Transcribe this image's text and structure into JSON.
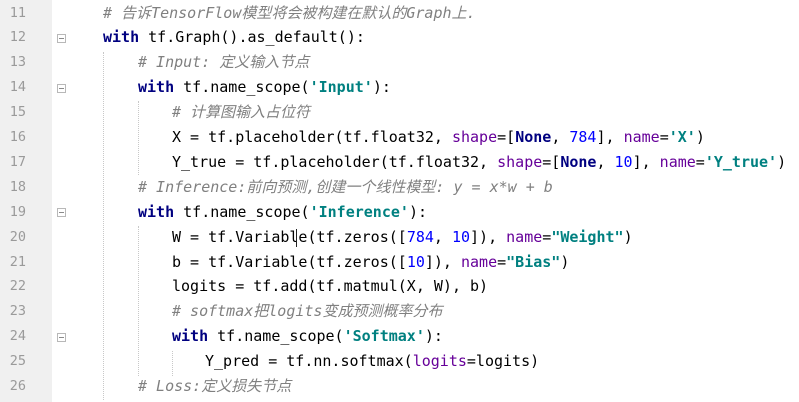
{
  "editor": {
    "lines": [
      {
        "number": "11",
        "tokens": [
          {
            "type": "comment",
            "text": "# 告诉TensorFlow模型将会被构建在默认的Graph上."
          }
        ]
      },
      {
        "number": "12",
        "tokens": [
          {
            "type": "kw",
            "text": "with"
          },
          {
            "type": "plain",
            "text": " tf.Graph().as_default():"
          }
        ]
      },
      {
        "number": "13",
        "tokens": [
          {
            "type": "comment",
            "text": "# Input: 定义输入节点"
          }
        ]
      },
      {
        "number": "14",
        "tokens": [
          {
            "type": "kw",
            "text": "with"
          },
          {
            "type": "plain",
            "text": " tf.name_scope("
          },
          {
            "type": "str",
            "text": "'Input'"
          },
          {
            "type": "plain",
            "text": "):"
          }
        ]
      },
      {
        "number": "15",
        "tokens": [
          {
            "type": "comment",
            "text": "# 计算图输入占位符"
          }
        ]
      },
      {
        "number": "16",
        "tokens": [
          {
            "type": "plain",
            "text": "X = tf.placeholder(tf.float32, "
          },
          {
            "type": "kwarg",
            "text": "shape"
          },
          {
            "type": "plain",
            "text": "=["
          },
          {
            "type": "const",
            "text": "None"
          },
          {
            "type": "plain",
            "text": ", "
          },
          {
            "type": "num",
            "text": "784"
          },
          {
            "type": "plain",
            "text": "], "
          },
          {
            "type": "kwarg",
            "text": "name"
          },
          {
            "type": "plain",
            "text": "="
          },
          {
            "type": "str",
            "text": "'X'"
          },
          {
            "type": "plain",
            "text": ")"
          }
        ]
      },
      {
        "number": "17",
        "tokens": [
          {
            "type": "plain",
            "text": "Y_true = tf.placeholder(tf.float32, "
          },
          {
            "type": "kwarg",
            "text": "shape"
          },
          {
            "type": "plain",
            "text": "=["
          },
          {
            "type": "const",
            "text": "None"
          },
          {
            "type": "plain",
            "text": ", "
          },
          {
            "type": "num",
            "text": "10"
          },
          {
            "type": "plain",
            "text": "], "
          },
          {
            "type": "kwarg",
            "text": "name"
          },
          {
            "type": "plain",
            "text": "="
          },
          {
            "type": "str",
            "text": "'Y_true'"
          },
          {
            "type": "plain",
            "text": ")"
          }
        ]
      },
      {
        "number": "18",
        "tokens": [
          {
            "type": "comment",
            "text": "# Inference:前向预测,创建一个线性模型: y = x*w + b"
          }
        ]
      },
      {
        "number": "19",
        "tokens": [
          {
            "type": "kw",
            "text": "with"
          },
          {
            "type": "plain",
            "text": " tf.name_scope("
          },
          {
            "type": "str",
            "text": "'Inference'"
          },
          {
            "type": "plain",
            "text": "):"
          }
        ]
      },
      {
        "number": "20",
        "tokens": [
          {
            "type": "plain",
            "text": "W = tf.Variable(tf.zeros(["
          },
          {
            "type": "num",
            "text": "784"
          },
          {
            "type": "plain",
            "text": ", "
          },
          {
            "type": "num",
            "text": "10"
          },
          {
            "type": "plain",
            "text": "]), "
          },
          {
            "type": "kwarg",
            "text": "name"
          },
          {
            "type": "plain",
            "text": "="
          },
          {
            "type": "str",
            "text": "\"Weight\""
          },
          {
            "type": "plain",
            "text": ")"
          }
        ]
      },
      {
        "number": "21",
        "tokens": [
          {
            "type": "plain",
            "text": "b = tf.Variable(tf.zeros(["
          },
          {
            "type": "num",
            "text": "10"
          },
          {
            "type": "plain",
            "text": "]), "
          },
          {
            "type": "kwarg",
            "text": "name"
          },
          {
            "type": "plain",
            "text": "="
          },
          {
            "type": "str",
            "text": "\"Bias\""
          },
          {
            "type": "plain",
            "text": ")"
          }
        ]
      },
      {
        "number": "22",
        "tokens": [
          {
            "type": "plain",
            "text": "logits = tf.add(tf.matmul(X, W), b)"
          }
        ]
      },
      {
        "number": "23",
        "tokens": [
          {
            "type": "comment",
            "text": "# softmax把logits变成预测概率分布"
          }
        ]
      },
      {
        "number": "24",
        "tokens": [
          {
            "type": "kw",
            "text": "with"
          },
          {
            "type": "plain",
            "text": " tf.name_scope("
          },
          {
            "type": "str",
            "text": "'Softmax'"
          },
          {
            "type": "plain",
            "text": "):"
          }
        ]
      },
      {
        "number": "25",
        "tokens": [
          {
            "type": "plain",
            "text": "Y_pred = tf.nn.softmax("
          },
          {
            "type": "kwarg",
            "text": "logits"
          },
          {
            "type": "plain",
            "text": "=logits)"
          }
        ]
      },
      {
        "number": "26",
        "tokens": [
          {
            "type": "comment",
            "text": "# Loss:定义损失节点"
          }
        ]
      }
    ]
  },
  "colors": {
    "keyword": "#000080",
    "string": "#008080",
    "kwarg": "#660099",
    "number": "#0000ff",
    "comment": "#808080",
    "gutter_bg": "#f0f0f0"
  }
}
